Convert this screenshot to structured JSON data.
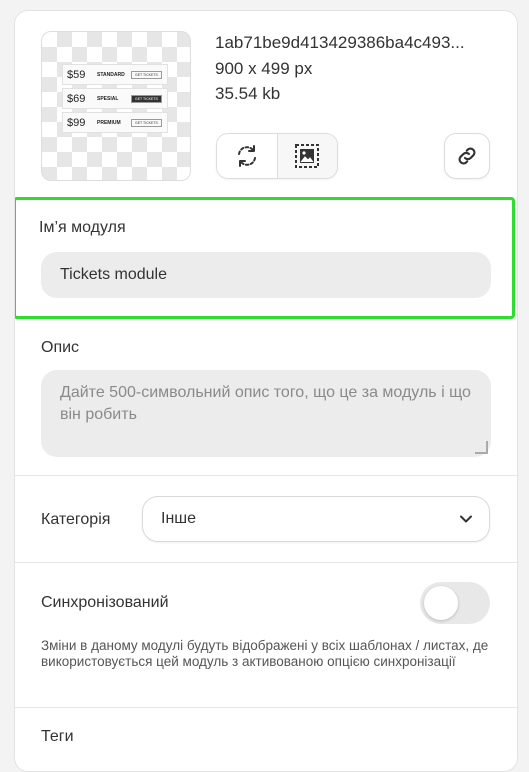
{
  "file": {
    "name": "1ab71be9d413429386ba4c493...",
    "dimensions": "900 x 499 px",
    "size": "35.54 kb",
    "preview_tickets": [
      {
        "price": "$59",
        "name": "STANDARD",
        "button": "GET TICKETS"
      },
      {
        "price": "$69",
        "name": "SPESIAL",
        "button": "GET TICKETS"
      },
      {
        "price": "$99",
        "name": "PREMIUM",
        "button": "GET TICKETS"
      }
    ]
  },
  "actions": {
    "replace_icon": "refresh-icon",
    "edit_image_icon": "image-edit-icon",
    "link_icon": "link-icon"
  },
  "module_name": {
    "label": "Ім’я модуля",
    "value": "Tickets module"
  },
  "description": {
    "label": "Опис",
    "placeholder": "Дайте 500-символьний опис того, що це за модуль і що він робить"
  },
  "category": {
    "label": "Категорія",
    "selected": "Інше"
  },
  "sync": {
    "label": "Синхронізований",
    "enabled": false,
    "help": "Зміни в даному модулі будуть відображені у всіх шаблонах / листах, де використовується цей модуль з активованою опцією синхронізації"
  },
  "tags": {
    "label": "Теги"
  },
  "colors": {
    "highlight": "#2fdc2f",
    "input_bg": "#ececec"
  }
}
